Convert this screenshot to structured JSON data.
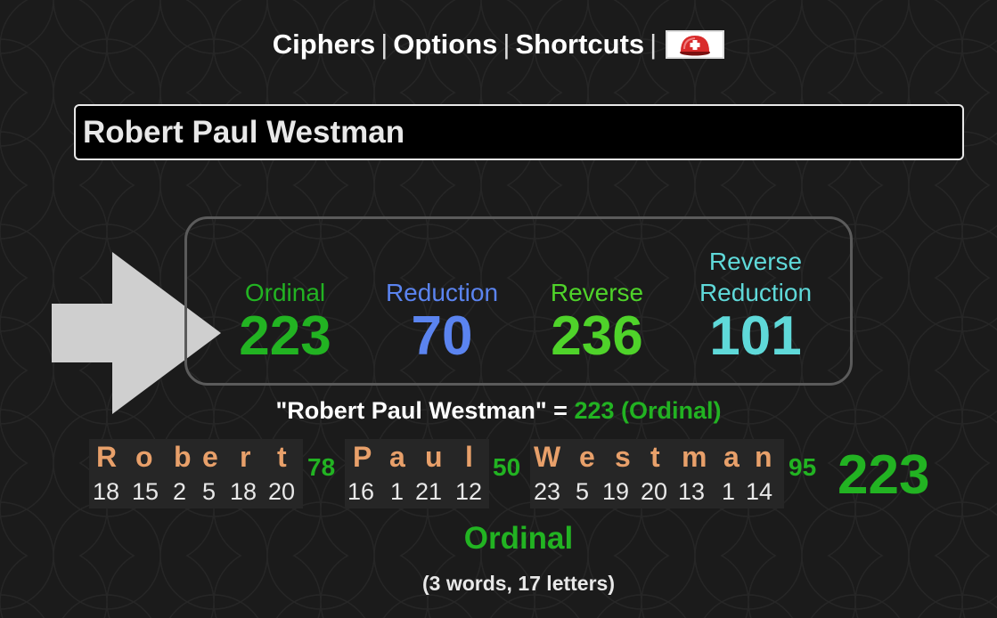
{
  "menu": {
    "ciphers": "Ciphers",
    "options": "Options",
    "shortcuts": "Shortcuts",
    "separator": "|",
    "help_icon": "medkit-icon"
  },
  "search": {
    "value": "Robert Paul Westman"
  },
  "ciphers": [
    {
      "name_line1": "",
      "name_line2": "Ordinal",
      "value": "223",
      "color": "#22b322"
    },
    {
      "name_line1": "",
      "name_line2": "Reduction",
      "value": "70",
      "color": "#5b84f0"
    },
    {
      "name_line1": "",
      "name_line2": "Reverse",
      "value": "236",
      "color": "#4fd32a"
    },
    {
      "name_line1": "Reverse",
      "name_line2": "Reduction",
      "value": "101",
      "color": "#5fd9d9"
    }
  ],
  "equation": {
    "phrase": "\"Robert Paul Westman\" =",
    "result": "223 (Ordinal)"
  },
  "breakdown": {
    "words": [
      {
        "letters": [
          "R",
          "o",
          "b",
          "e",
          "r",
          "t"
        ],
        "values": [
          "18",
          "15",
          "2",
          "5",
          "18",
          "20"
        ],
        "sum": "78"
      },
      {
        "letters": [
          "P",
          "a",
          "u",
          "l"
        ],
        "values": [
          "16",
          "1",
          "21",
          "12"
        ],
        "sum": "50"
      },
      {
        "letters": [
          "W",
          "e",
          "s",
          "t",
          "m",
          "a",
          "n"
        ],
        "values": [
          "23",
          "5",
          "19",
          "20",
          "13",
          "1",
          "14"
        ],
        "sum": "95"
      }
    ],
    "total": "223",
    "cipher_name": "Ordinal",
    "counts": "(3 words, 17 letters)"
  },
  "colors": {
    "background": "#1b1b1b",
    "ordinal": "#22b322",
    "reduction": "#5b84f0",
    "reverse": "#4fd32a",
    "reverse_reduction": "#5fd9d9",
    "letter": "#e8a06a"
  }
}
